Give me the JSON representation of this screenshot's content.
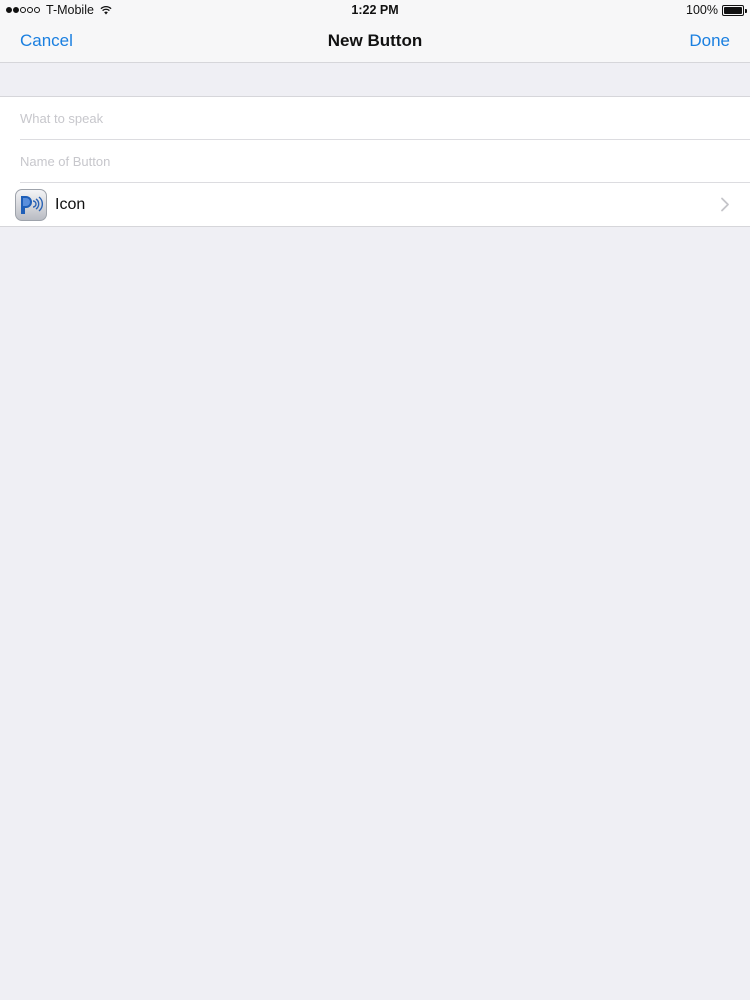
{
  "status_bar": {
    "signal_filled": 2,
    "signal_total": 5,
    "carrier": "T-Mobile",
    "time": "1:22 PM",
    "battery": "100%",
    "battery_level": 1.0
  },
  "nav": {
    "cancel_label": "Cancel",
    "title": "New Button",
    "done_label": "Done",
    "accent_color": "#1a7fe0"
  },
  "form": {
    "speak_placeholder": "What to speak",
    "speak_value": "",
    "name_placeholder": "Name of Button",
    "name_value": "",
    "icon_label": "Icon",
    "icon_name": "speaker-app-icon"
  }
}
